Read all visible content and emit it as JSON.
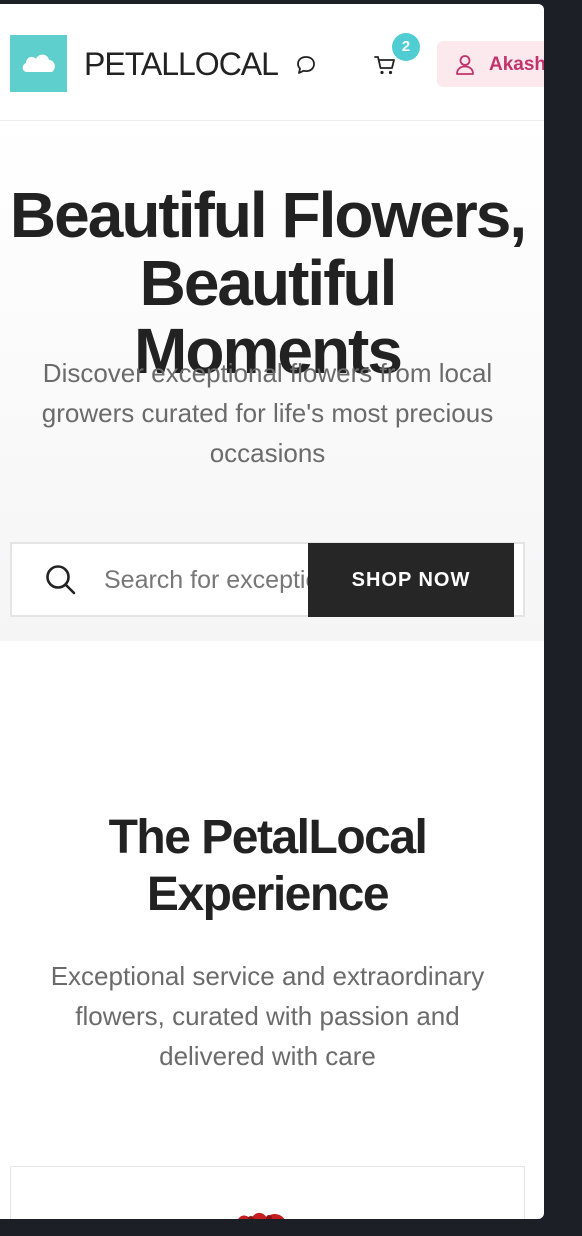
{
  "header": {
    "brand": "PETALLOCAL",
    "cart_count": "2",
    "account_name": "Akash",
    "icons": [
      "cloud-logo-icon",
      "chat-icon",
      "cart-icon",
      "user-icon"
    ]
  },
  "hero": {
    "title_line1": "Beautiful Flowers,",
    "title_line2": "Beautiful Moments",
    "subtitle": "Discover exceptional flowers from local growers curated for life's most precious occasions",
    "search_placeholder": "Search for exceptional flowers",
    "shop_button": "SHOP NOW"
  },
  "experience": {
    "title_line1": "The PetalLocal",
    "title_line2": "Experience",
    "subtitle": "Exceptional service and extraordinary flowers, curated with passion and delivered with care"
  },
  "colors": {
    "logo": "#5fcfcd",
    "badge": "#4fcdd3",
    "account_bg": "#fbe9ee",
    "account_text": "#c2336b",
    "button_dark": "#262626"
  }
}
